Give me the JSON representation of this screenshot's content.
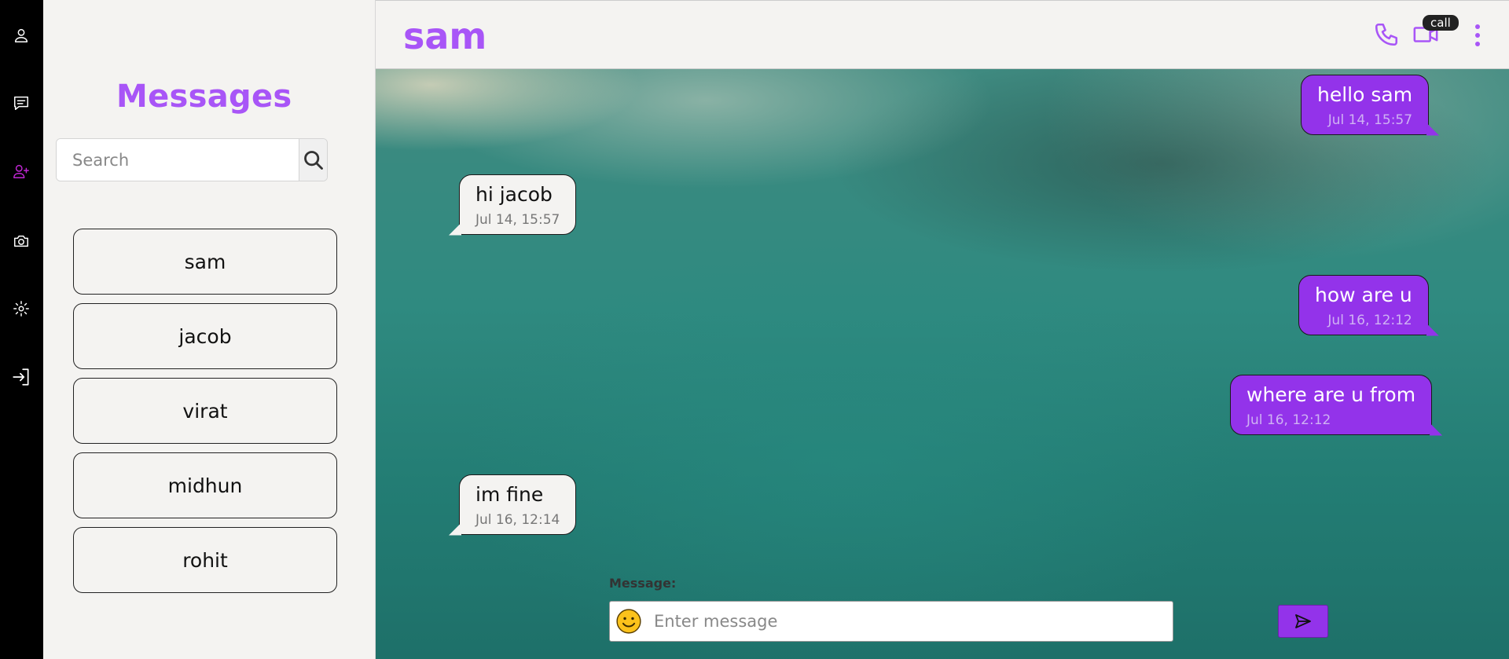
{
  "sidebar": {
    "icons": [
      "user-icon",
      "chat-icon",
      "add-user-icon",
      "camera-icon",
      "gear-icon",
      "logout-icon"
    ],
    "active_icon": "add-user-icon",
    "accent": "#c026d3"
  },
  "contacts": {
    "title": "Messages",
    "search_placeholder": "Search",
    "items": [
      {
        "label": "sam"
      },
      {
        "label": "jacob"
      },
      {
        "label": "virat"
      },
      {
        "label": "midhun"
      },
      {
        "label": "rohit"
      }
    ]
  },
  "chat": {
    "name": "sam",
    "tooltip": "call",
    "messages": [
      {
        "direction": "sent",
        "text": "hello sam",
        "time": "Jul 14, 15:57"
      },
      {
        "direction": "received",
        "text": "hi jacob",
        "time": "Jul 14, 15:57"
      },
      {
        "direction": "sent",
        "text": "how are u",
        "time": "Jul 16, 12:12"
      },
      {
        "direction": "sent",
        "text": "where are u from",
        "time": "Jul 16, 12:12"
      },
      {
        "direction": "received",
        "text": "im fine",
        "time": "Jul 16, 12:14"
      }
    ]
  },
  "composer": {
    "label": "Message:",
    "placeholder": "Enter message",
    "value": ""
  },
  "colors": {
    "brand": "#a855f7",
    "sent_bubble": "#9333ea",
    "received_bubble": "#f4f3f1",
    "panel": "#f4f3f1",
    "rail": "#000000"
  }
}
